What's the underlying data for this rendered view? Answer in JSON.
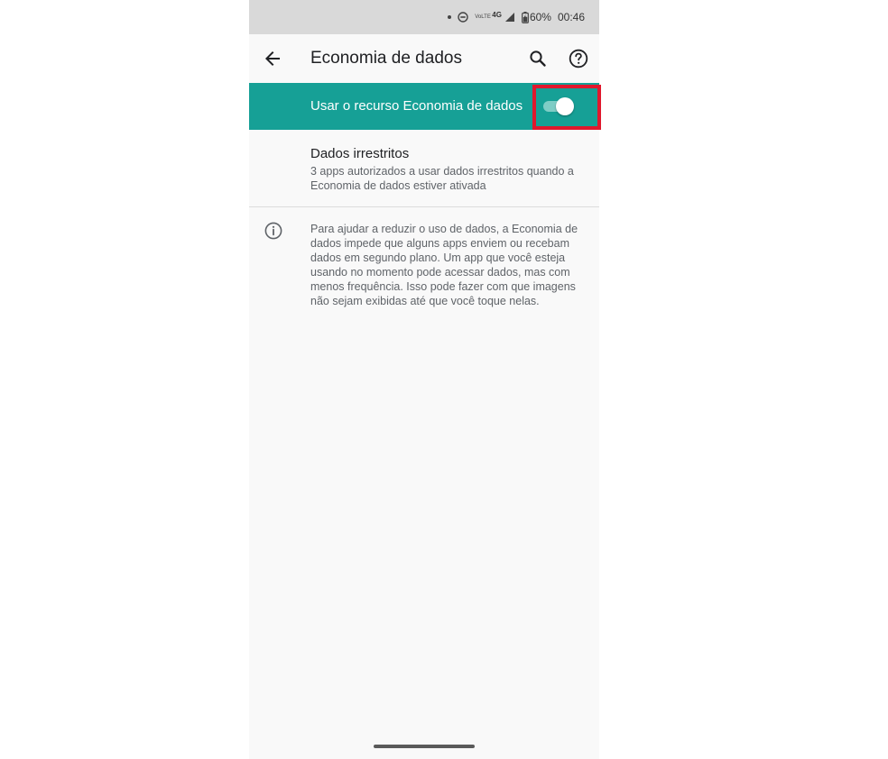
{
  "status_bar": {
    "dot_icon": "notification-dot",
    "dnd_icon": "do-not-disturb-icon",
    "volte_label": "VoLTE",
    "network_label": "4G",
    "signal_icon": "signal-icon",
    "battery_icon": "battery-charging-icon",
    "battery_percent": "60%",
    "time": "00:46"
  },
  "app_bar": {
    "title": "Economia de dados",
    "back_icon": "arrow-back-icon",
    "search_icon": "search-icon",
    "help_icon": "help-icon"
  },
  "master_switch": {
    "label": "Usar o recurso Economia de dados",
    "checked": true,
    "background_color": "#16a096",
    "highlight_color": "#e0182d"
  },
  "unrestricted_data": {
    "title": "Dados irrestritos",
    "summary": "3 apps autorizados a usar dados irrestritos quando a Economia de dados estiver ativada"
  },
  "footer_info": {
    "icon": "info-icon",
    "text": "Para ajudar a reduzir o uso de dados, a Economia de dados impede que alguns apps enviem ou recebam dados em segundo plano. Um app que você esteja usando no momento pode acessar dados, mas com menos frequência. Isso pode fazer com que imagens não sejam exibidas até que você toque nelas."
  },
  "nav": {
    "handle": "gesture-nav-handle"
  }
}
